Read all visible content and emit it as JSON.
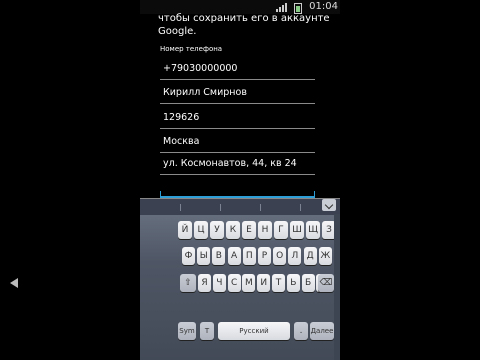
{
  "status": {
    "time": "01:04"
  },
  "form": {
    "intro": "чтобы сохранить его в аккаунте Google.",
    "phone_label": "Номер телефона",
    "phone": "+79030000000",
    "name": "Кирилл Смирнов",
    "zip": "129626",
    "city": "Москва",
    "street": "ул. Космонавтов, 44, кв 24"
  },
  "keyboard": {
    "row1": [
      "Й",
      "Ц",
      "У",
      "К",
      "Е",
      "Н",
      "Г",
      "Ш",
      "Щ",
      "З",
      "Х"
    ],
    "row2": [
      "Ф",
      "Ы",
      "В",
      "А",
      "П",
      "Р",
      "О",
      "Л",
      "Д",
      "Ж",
      "Э"
    ],
    "row3": [
      "Я",
      "Ч",
      "С",
      "М",
      "И",
      "Т",
      "Ь",
      "Б",
      "Ю"
    ],
    "symbols_label": "Sym",
    "mode_label": "T",
    "space_label": "Русский",
    "dot_label": ".",
    "next_label": "Далее"
  }
}
